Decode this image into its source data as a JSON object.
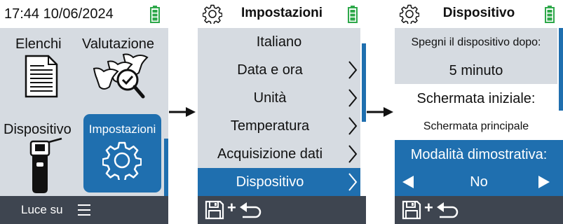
{
  "colors": {
    "accent": "#1f6faf",
    "panel": "#d6dbe1",
    "footer": "#3e4550",
    "battery": "#2ea84a"
  },
  "screen1": {
    "statusbar": {
      "datetime": "17:44 10/06/2024",
      "battery_icon": "battery-full-icon"
    },
    "tiles": [
      {
        "label": "Elenchi",
        "icon": "document-list-icon",
        "selected": false
      },
      {
        "label": "Valutazione",
        "icon": "cow-check-icon",
        "selected": false
      },
      {
        "label": "Dispositivo",
        "icon": "handheld-reader-icon",
        "selected": false
      },
      {
        "label": "Impostazioni",
        "icon": "gear-icon",
        "selected": true
      }
    ],
    "footer": {
      "text": "Luce su",
      "menu_icon": "hamburger-menu-icon"
    }
  },
  "screen2": {
    "header": {
      "title": "Impostazioni",
      "icon": "gear-icon",
      "battery_icon": "battery-full-icon"
    },
    "items": [
      {
        "label": "Italiano",
        "chevron": false,
        "selected": false
      },
      {
        "label": "Data e ora",
        "chevron": true,
        "selected": false
      },
      {
        "label": "Unità",
        "chevron": true,
        "selected": false
      },
      {
        "label": "Temperatura",
        "chevron": true,
        "selected": false
      },
      {
        "label": "Acquisizione dati",
        "chevron": true,
        "selected": false
      },
      {
        "label": "Dispositivo",
        "chevron": true,
        "selected": true
      }
    ],
    "footer": {
      "save_icon": "floppy-save-icon",
      "plus": "+",
      "back_icon": "undo-arrow-icon"
    }
  },
  "screen3": {
    "header": {
      "title": "Dispositivo",
      "icon": "gear-icon",
      "battery_icon": "battery-full-icon"
    },
    "settings": {
      "shutdown_label": "Spegni il dispositivo dopo:",
      "shutdown_value": "5 minuto",
      "home_label": "Schermata iniziale:",
      "home_value": "Schermata principale",
      "demo_label": "Modalità dimostrativa:",
      "demo_value": "No"
    },
    "footer": {
      "save_icon": "floppy-save-icon",
      "plus": "+",
      "back_icon": "undo-arrow-icon"
    }
  },
  "arrows": [
    "right-arrow-icon",
    "right-arrow-icon"
  ]
}
